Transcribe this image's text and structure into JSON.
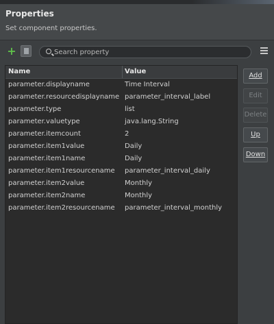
{
  "header": {
    "title": "Properties",
    "subtitle": "Set component properties."
  },
  "toolbar": {
    "add_icon": "plus-icon",
    "doc_icon": "document-icon",
    "search_placeholder": "Search property",
    "search_value": "",
    "menu_icon": "menu-icon",
    "accent_green": "#5fbf4a"
  },
  "table": {
    "columns": [
      "Name",
      "Value"
    ],
    "rows": [
      {
        "name": "parameter.displayname",
        "value": "Time Interval"
      },
      {
        "name": "parameter.resourcedisplayname",
        "value": "parameter_interval_label"
      },
      {
        "name": "parameter.type",
        "value": "list"
      },
      {
        "name": "parameter.valuetype",
        "value": "java.lang.String"
      },
      {
        "name": "parameter.itemcount",
        "value": "2"
      },
      {
        "name": "parameter.item1value",
        "value": "Daily"
      },
      {
        "name": "parameter.item1name",
        "value": "Daily"
      },
      {
        "name": "parameter.item1resourcename",
        "value": "parameter_interval_daily"
      },
      {
        "name": "parameter.item2value",
        "value": "Monthly"
      },
      {
        "name": "parameter.item2name",
        "value": "Monthly"
      },
      {
        "name": "parameter.item2resourcename",
        "value": "parameter_interval_monthly"
      }
    ]
  },
  "buttons": {
    "add": "Add",
    "edit": "Edit",
    "delete": "Delete",
    "up": "Up",
    "down": "Down"
  }
}
